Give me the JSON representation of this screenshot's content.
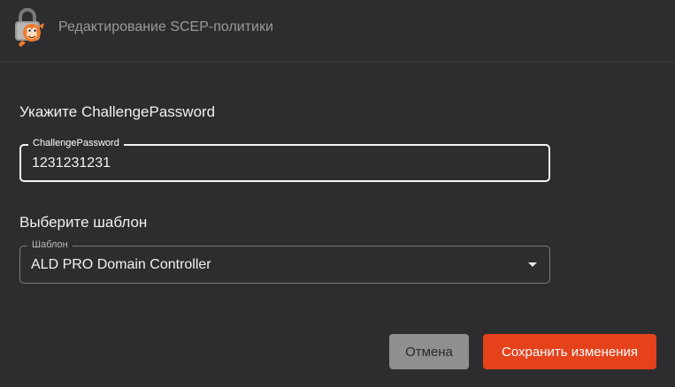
{
  "header": {
    "title": "Редактирование SCEP-политики",
    "logo_icon": "lock-mascot-icon"
  },
  "challenge_section": {
    "title": "Укажите ChallengePassword",
    "field_label": "ChallengePassword",
    "field_value": "1231231231"
  },
  "template_section": {
    "title": "Выберите шаблон",
    "field_label": "Шаблон",
    "selected_value": "ALD PRO Domain Controller"
  },
  "actions": {
    "cancel_label": "Отмена",
    "save_label": "Сохранить изменения"
  },
  "colors": {
    "background": "#2d2d2f",
    "accent": "#e5411b",
    "cancel_bg": "#8f8f92"
  }
}
